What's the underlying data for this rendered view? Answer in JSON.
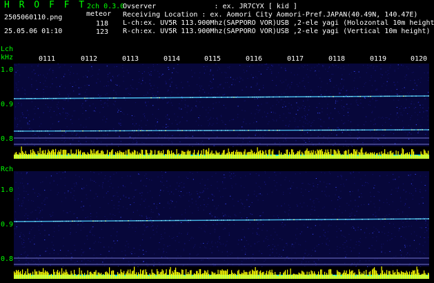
{
  "header": {
    "app_name": "H R O F F T",
    "mode": "2ch 0.3.0",
    "filename": "2505060110.png",
    "datetime": "25.05.06 01:10",
    "counts": {
      "label": "meteor",
      "lch": "118",
      "rch": "123"
    },
    "info": {
      "observer": "Ovserver              : ex. JR7CYX [ kid ]",
      "location": "Receiving Location : ex. Aomori City Aomori-Pref.JAPAN(40.49N, 140.47E)",
      "lch_config": "L-ch:ex. UV5R 113.900Mhz(SAPPORO VOR)USB ,2-ele yagi (Holozontal 10m height",
      "rch_config": "R-ch:ex. UV5R 113.900Mhz(SAPPORO VOR)USB ,2-ele yagi (Vertical 10m height)"
    }
  },
  "time_axis": {
    "labels": [
      "0111",
      "0112",
      "0113",
      "0114",
      "0115",
      "0116",
      "0117",
      "0118",
      "0119",
      "0120"
    ]
  },
  "lch": {
    "label": "Lch",
    "unit": "kHz",
    "y_ticks": [
      "1.0",
      "0.9",
      "0.8"
    ]
  },
  "rch": {
    "label": "Rch",
    "y_ticks": [
      "1.0",
      "0.9",
      "0.8"
    ]
  },
  "colors": {
    "text": "#00ff00",
    "info_text": "#ffffff",
    "background": "#000000",
    "spectrum_bg": "#07073a",
    "signal": "#4fd0ff",
    "level_yellow": "#ffff00",
    "level_cyan": "#00e5ff"
  }
}
